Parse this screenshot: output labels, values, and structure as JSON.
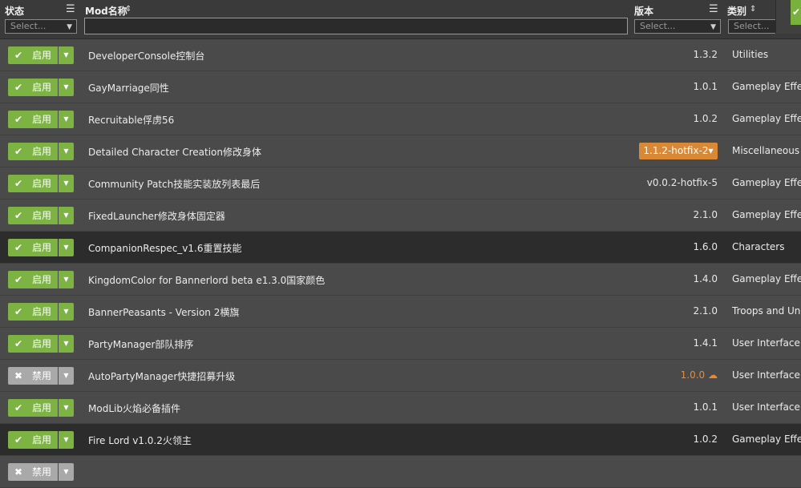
{
  "header": {
    "status_label": "状态",
    "name_label": "Mod名称",
    "version_label": "版本",
    "category_label": "类别",
    "list_icon": "list-icon",
    "sort_icon": "sort-icon",
    "status_select_placeholder": "Select...",
    "version_select_placeholder": "Select...",
    "category_select_placeholder": "Select...",
    "name_filter_value": ""
  },
  "top_right_button_icon": "check-icon",
  "colors": {
    "enabled": "#7cb342",
    "disabled": "#a9a9a9",
    "warning": "#f0892c",
    "badge": "#d98835"
  },
  "mods": [
    {
      "status": "启用",
      "enabled": true,
      "name": "DeveloperConsole控制台",
      "version": "1.3.2",
      "category": "Utilities"
    },
    {
      "status": "启用",
      "enabled": true,
      "name": "GayMarriage同性",
      "version": "1.0.1",
      "category": "Gameplay Effec"
    },
    {
      "status": "启用",
      "enabled": true,
      "name": "Recruitable俘虏56",
      "version": "1.0.2",
      "category": "Gameplay Effec"
    },
    {
      "status": "启用",
      "enabled": true,
      "name": "Detailed Character Creation修改身体",
      "version": "1.1.2-hotfix-2▾",
      "category": "Miscellaneous",
      "version_badge": true
    },
    {
      "status": "启用",
      "enabled": true,
      "name": "Community Patch技能实装放列表最后",
      "version": "v0.0.2-hotfix-5",
      "category": "Gameplay Effec"
    },
    {
      "status": "启用",
      "enabled": true,
      "name": "FixedLauncher修改身体固定器",
      "version": "2.1.0",
      "category": "Gameplay Effec"
    },
    {
      "status": "启用",
      "enabled": true,
      "name": "CompanionRespec_v1.6重置技能",
      "version": "1.6.0",
      "category": "Characters",
      "selected": true
    },
    {
      "status": "启用",
      "enabled": true,
      "name": "KingdomColor for Bannerlord beta e1.3.0国家颜色",
      "version": "1.4.0",
      "category": "Gameplay Effec"
    },
    {
      "status": "启用",
      "enabled": true,
      "name": "BannerPeasants - Version 2横旗",
      "version": "2.1.0",
      "category": "Troops and Unit"
    },
    {
      "status": "启用",
      "enabled": true,
      "name": "PartyManager部队排序",
      "version": "1.4.1",
      "category": "User Interface"
    },
    {
      "status": "禁用",
      "enabled": false,
      "name": "AutoPartyManager快捷招募升级",
      "version": "1.0.0",
      "category": "User Interface",
      "version_warning": true
    },
    {
      "status": "启用",
      "enabled": true,
      "name": "ModLib火焰必备插件",
      "version": "1.0.1",
      "category": "User Interface"
    },
    {
      "status": "启用",
      "enabled": true,
      "name": "Fire Lord v1.0.2火领主",
      "version": "1.0.2",
      "category": "Gameplay Effec",
      "selected": true
    },
    {
      "status": "禁用",
      "enabled": false,
      "name": "",
      "version": "",
      "category": ""
    }
  ]
}
